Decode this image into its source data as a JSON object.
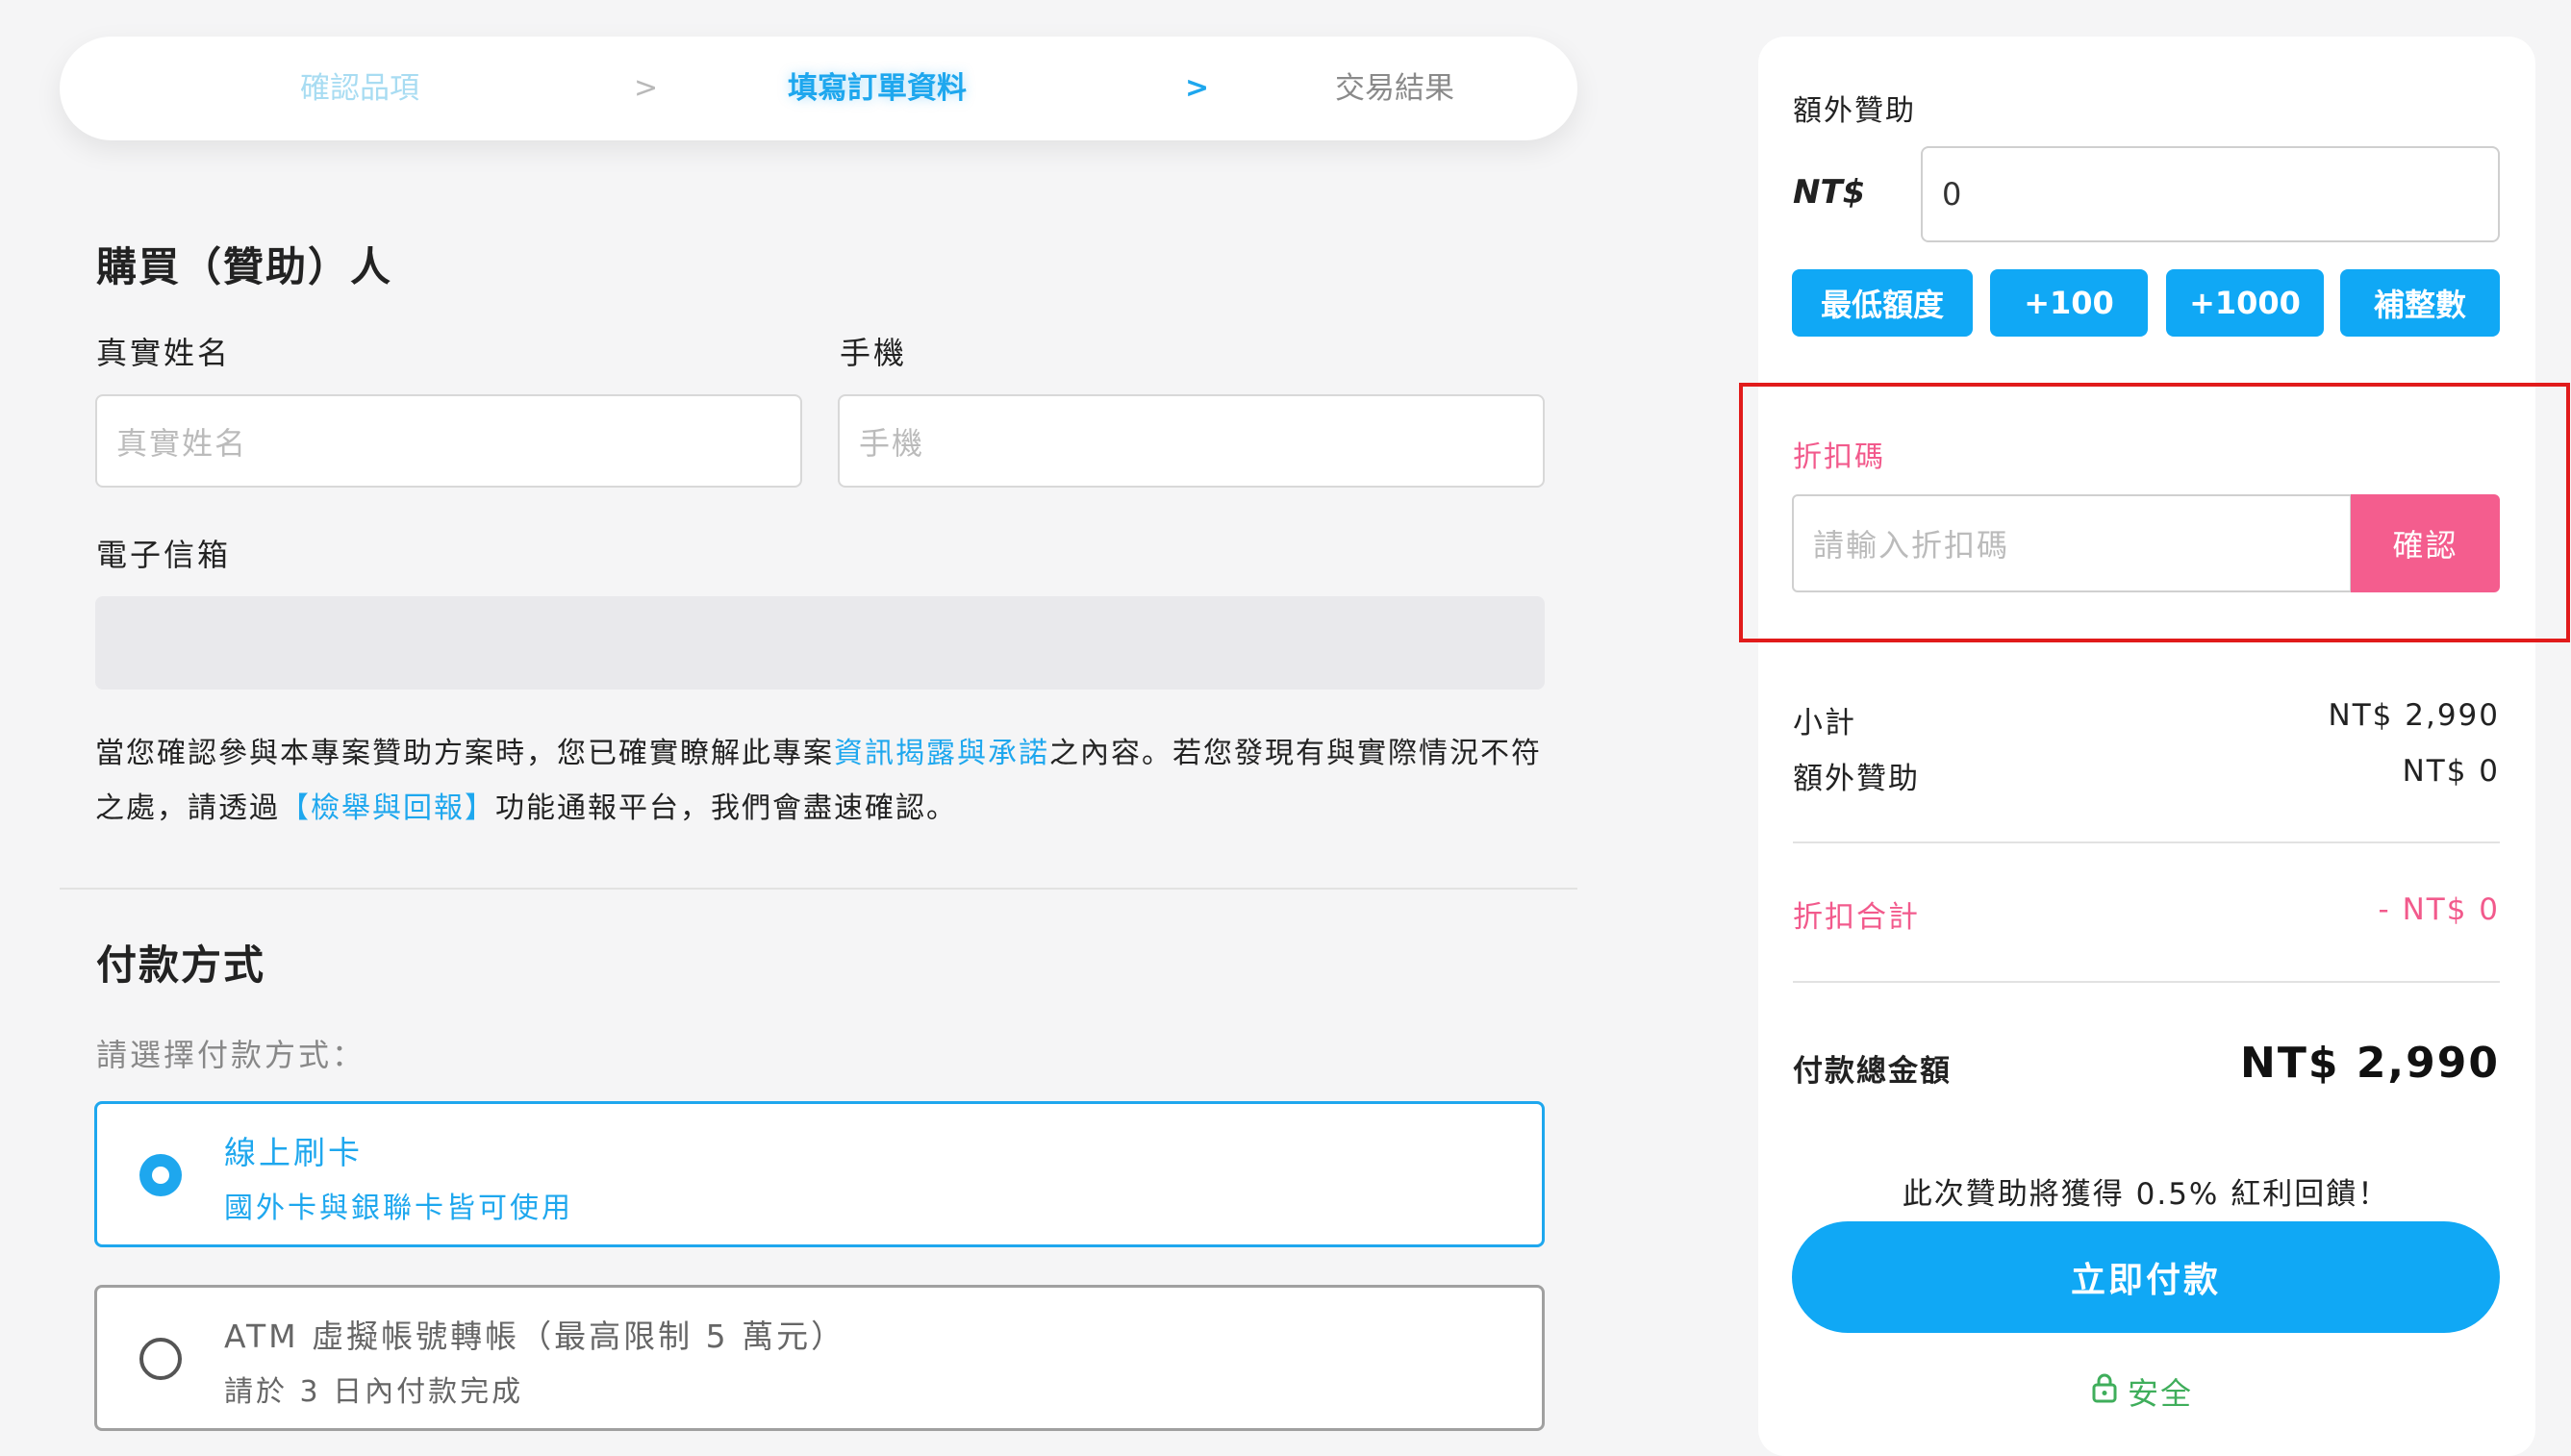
{
  "steps": {
    "step1": "確認品項",
    "sep1": ">",
    "step2": "填寫訂單資料",
    "sep2": ">",
    "step3": "交易結果"
  },
  "buyer": {
    "title": "購買（贊助）人",
    "name_label": "真實姓名",
    "name_placeholder": "真實姓名",
    "phone_label": "手機",
    "phone_placeholder": "手機",
    "email_label": "電子信箱",
    "email_value": ""
  },
  "notice": {
    "part1": "當您確認參與本專案贊助方案時，您已確實瞭解此專案",
    "link1": "資訊揭露與承諾",
    "part2": "之內容。若您發現有與實際情況不符之處，請透過",
    "link2": "【檢舉與回報】",
    "part3": "功能通報平台，我們會盡速確認。"
  },
  "payment": {
    "title": "付款方式",
    "prompt": "請選擇付款方式：",
    "options": [
      {
        "title": "線上刷卡",
        "subtitle": "國外卡與銀聯卡皆可使用",
        "selected": true
      },
      {
        "title": "ATM 虛擬帳號轉帳（最高限制 5 萬元）",
        "subtitle": "請於 3 日內付款完成",
        "selected": false
      }
    ]
  },
  "extra": {
    "label": "額外贊助",
    "currency": "NT$",
    "value": "0",
    "buttons": [
      "最低額度",
      "+100",
      "+1000",
      "補整數"
    ]
  },
  "discount": {
    "label": "折扣碼",
    "placeholder": "請輸入折扣碼",
    "confirm": "確認"
  },
  "summary": {
    "subtotal_label": "小計",
    "subtotal_value": "NT$ 2,990",
    "extra_label": "額外贊助",
    "extra_value": "NT$ 0",
    "discount_label": "折扣合計",
    "discount_value": "- NT$ 0",
    "total_label": "付款總金額",
    "total_value": "NT$ 2,990",
    "bonus_text": "此次贊助將獲得 0.5% 紅利回饋！",
    "pay_button": "立即付款",
    "secure_text": "安全"
  },
  "colors": {
    "accent": "#10a8f5",
    "pink": "#f45d8e",
    "highlight_border": "#e11b1b",
    "secure_green": "#3fae5b"
  },
  "icons": {
    "lock": "lock-icon"
  }
}
